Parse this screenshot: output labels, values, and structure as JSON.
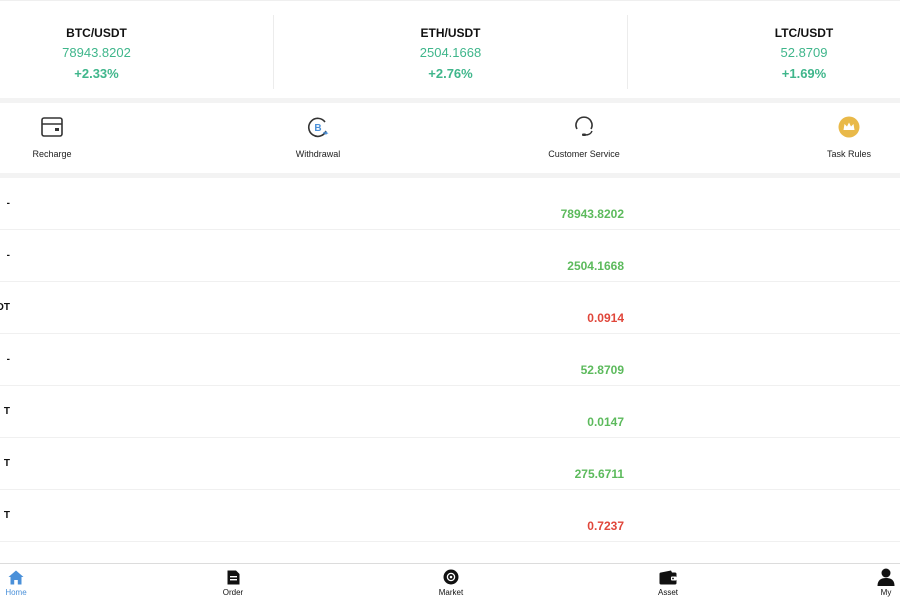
{
  "ticker": [
    {
      "pair": "BTC/USDT",
      "price": "78943.8202",
      "change": "+2.33%"
    },
    {
      "pair": "ETH/USDT",
      "price": "2504.1668",
      "change": "+2.76%"
    },
    {
      "pair": "LTC/USDT",
      "price": "52.8709",
      "change": "+1.69%"
    }
  ],
  "actions": {
    "recharge": "Recharge",
    "withdrawal": "Withdrawal",
    "customer_service": "Customer Service",
    "task_rules": "Task Rules"
  },
  "market": [
    {
      "symbol": "-",
      "value": "78943.8202",
      "trend": "up"
    },
    {
      "symbol": "-",
      "value": "2504.1668",
      "trend": "up"
    },
    {
      "symbol": "DT",
      "value": "0.0914",
      "trend": "down"
    },
    {
      "symbol": "-",
      "value": "52.8709",
      "trend": "up"
    },
    {
      "symbol": "T",
      "value": "0.0147",
      "trend": "up"
    },
    {
      "symbol": "T",
      "value": "275.6711",
      "trend": "up"
    },
    {
      "symbol": "T",
      "value": "0.7237",
      "trend": "down"
    }
  ],
  "tabs": {
    "home": "Home",
    "order": "Order",
    "market": "Market",
    "asset": "Asset",
    "my": "My"
  },
  "colors": {
    "up": "#5cba5c",
    "down": "#e0463a",
    "ticker_green": "#3fb68b",
    "active_tab": "#4a90d9",
    "crown": "#e9b949"
  }
}
